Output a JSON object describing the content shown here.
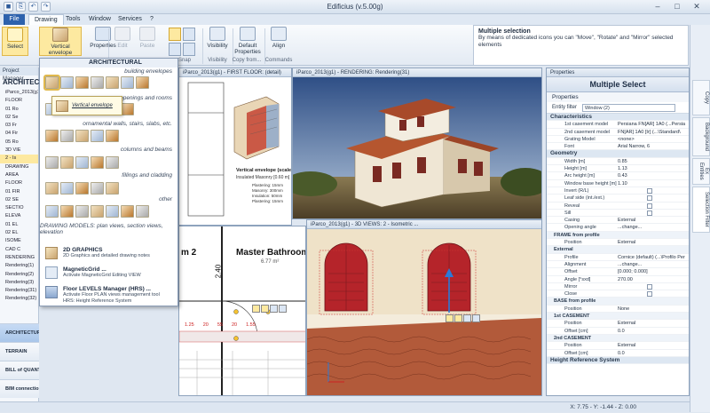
{
  "window": {
    "title": "Edificius (v.5.00g)",
    "controls": [
      "–",
      "□",
      "✕"
    ]
  },
  "quick_access": [
    "◼",
    "⎘",
    "↶",
    "↷"
  ],
  "tabs": [
    "File",
    "Drawing",
    "Tools",
    "Window",
    "Services",
    "?"
  ],
  "ribbon": {
    "buttons": [
      "Select",
      "Vertical envelope",
      "Properties",
      "Edit",
      "Paste",
      "Visibility",
      "Default Properties",
      "Align"
    ],
    "groups": [
      "Snap",
      "Visibility",
      "Copy from...",
      "Commands"
    ]
  },
  "info": {
    "title": "Multiple selection",
    "text": "By means of dedicated icons you can \"Move\", \"Rotate\" and \"Mirror\" selected elements"
  },
  "right_strip": [
    "Copy",
    "Background",
    "Ex Entities",
    "Selection Filter"
  ],
  "left_panel": {
    "header": "Project Manager",
    "title": "ARCHITEC",
    "tree": [
      "iParco_2013(g1)",
      "FLOOR",
      "01 Ro",
      "02 Se",
      "03 Fr",
      "04 Fir",
      "05 Ro",
      "3D VIE",
      "2 - Is",
      "DRAWING",
      "AREA",
      "FLOOR",
      "01 FIR",
      "02 SE",
      "SECTIO",
      "ELEVA",
      "01 EL",
      "02 EL",
      "ISOME",
      "CAD C",
      "RENDERING",
      "Rendering(1)",
      "Rendering(2)",
      "Rendering(3)",
      "Rendering(31)",
      "Rendering(32)"
    ],
    "selected_index": 8,
    "bottom": [
      "ARCHITECTURAL",
      "TERRAIN",
      "BILL of QUANTITIES (PriMus)",
      "BIM connection..."
    ]
  },
  "dropdown": {
    "title": "ARCHITECTURAL",
    "categories": [
      "building envelopes",
      "openings and rooms",
      "ornamental walls, stairs, slabs, etc.",
      "columns and beams",
      "fillings and cladding",
      "other",
      "DRAWING MODELS: plan views, section views, elevation"
    ],
    "tooltip": "Vertical envelope",
    "items": [
      {
        "title": "2D GRAPHICS",
        "desc": "2D Graphics and detailed drawing notes"
      },
      {
        "title": "MagneticGrid ...",
        "desc": "Activate MagneticGrid Editing VIEW"
      },
      {
        "title": "Floor LEVELS Manager (HRS) ...",
        "desc": "Activate Floor PLAN views management tool\nHRS: Height Reference System"
      }
    ]
  },
  "views": {
    "detail": {
      "title": "iParco_2013(g1) - FIRST FLOOR: (detail)",
      "caption": "Vertical envelope (scale 1:25)",
      "subcaption": "Insulated Masonry [0.60 m]",
      "layers": [
        "Plastering: 15mm",
        "Masonry: 300mm",
        "Insulation: 50mm",
        "Plastering: 15mm"
      ]
    },
    "render": {
      "title": "iParco_2013(g1) - RENDERING: Rendering(31)"
    },
    "plan": {
      "title": "",
      "room_label": "Master Bathroom",
      "room_area": "6.77 m²",
      "room_num": "m 2",
      "dim": "2.40",
      "dims": [
        "1.25",
        "20",
        "55",
        "20",
        "1.55"
      ]
    },
    "iso": {
      "title": "iParco_2013(g1) - 3D VIEWS: 2 - Isometric ..."
    }
  },
  "properties": {
    "header": "Properties",
    "title": "Multiple Select",
    "tab": "Properties",
    "entity_filter_label": "Entity filter",
    "entity_filter_value": "Window (2)",
    "rows": [
      {
        "type": "sec",
        "k": "Characteristics"
      },
      {
        "k": "1st casement model",
        "v": "Persiana FN[AR] 1A0  (...Persia"
      },
      {
        "k": "2nd casement model",
        "v": "FN[AR] 1A0 [Ir]  (...\\Standard\\"
      },
      {
        "k": "Grating Model",
        "v": "<none>"
      },
      {
        "k": "Font",
        "v": "Arial Narrow, 6"
      },
      {
        "type": "sec",
        "k": "Geometry"
      },
      {
        "k": "Width  [m]",
        "v": "0.85"
      },
      {
        "k": "Height  [m]",
        "v": "1.13"
      },
      {
        "k": "Arc height  [m]",
        "v": "0.43"
      },
      {
        "k": "Window base height  [m]",
        "v": "1.10"
      },
      {
        "k": "Invert (R/L)",
        "v": "",
        "chk": true
      },
      {
        "k": "Leaf side (int./ext.)",
        "v": "",
        "chk": true
      },
      {
        "k": "Reveal",
        "v": "",
        "chk": true
      },
      {
        "k": "Sill",
        "v": "",
        "chk": true
      },
      {
        "k": "Casing",
        "v": "External"
      },
      {
        "k": "Opening angle",
        "v": "...change..."
      },
      {
        "type": "sub",
        "k": "FRAME from profile"
      },
      {
        "k": "Position",
        "v": "External"
      },
      {
        "type": "sub",
        "k": "External"
      },
      {
        "k": "Profile",
        "v": "Cornice (default)  (...\\Profilo Per"
      },
      {
        "k": "Alignment",
        "v": "...change..."
      },
      {
        "k": "Offset",
        "v": "[0.000; 0.000]"
      },
      {
        "k": "Angle  [°sxd]",
        "v": "270.00"
      },
      {
        "k": "Mirror",
        "v": "",
        "chk": true
      },
      {
        "k": "Close",
        "v": "",
        "chk": true
      },
      {
        "type": "sub",
        "k": "BASE from profile"
      },
      {
        "k": "Position",
        "v": "None"
      },
      {
        "type": "sub",
        "k": "1st CASEMENT"
      },
      {
        "k": "Position",
        "v": "External"
      },
      {
        "k": "Offset  [cm]",
        "v": "0.0"
      },
      {
        "type": "sub",
        "k": "2nd CASEMENT"
      },
      {
        "k": "Position",
        "v": "External"
      },
      {
        "k": "Offset  [cm]",
        "v": "0.0"
      },
      {
        "type": "sec",
        "k": "Height Reference System"
      }
    ]
  },
  "status": {
    "coords": "X: 7.75 - Y: -1.44 - Z: 0.00"
  },
  "colors": {
    "accent": "#2d62ad",
    "window_red": "#b5242a",
    "roof": "#b25a3a"
  }
}
